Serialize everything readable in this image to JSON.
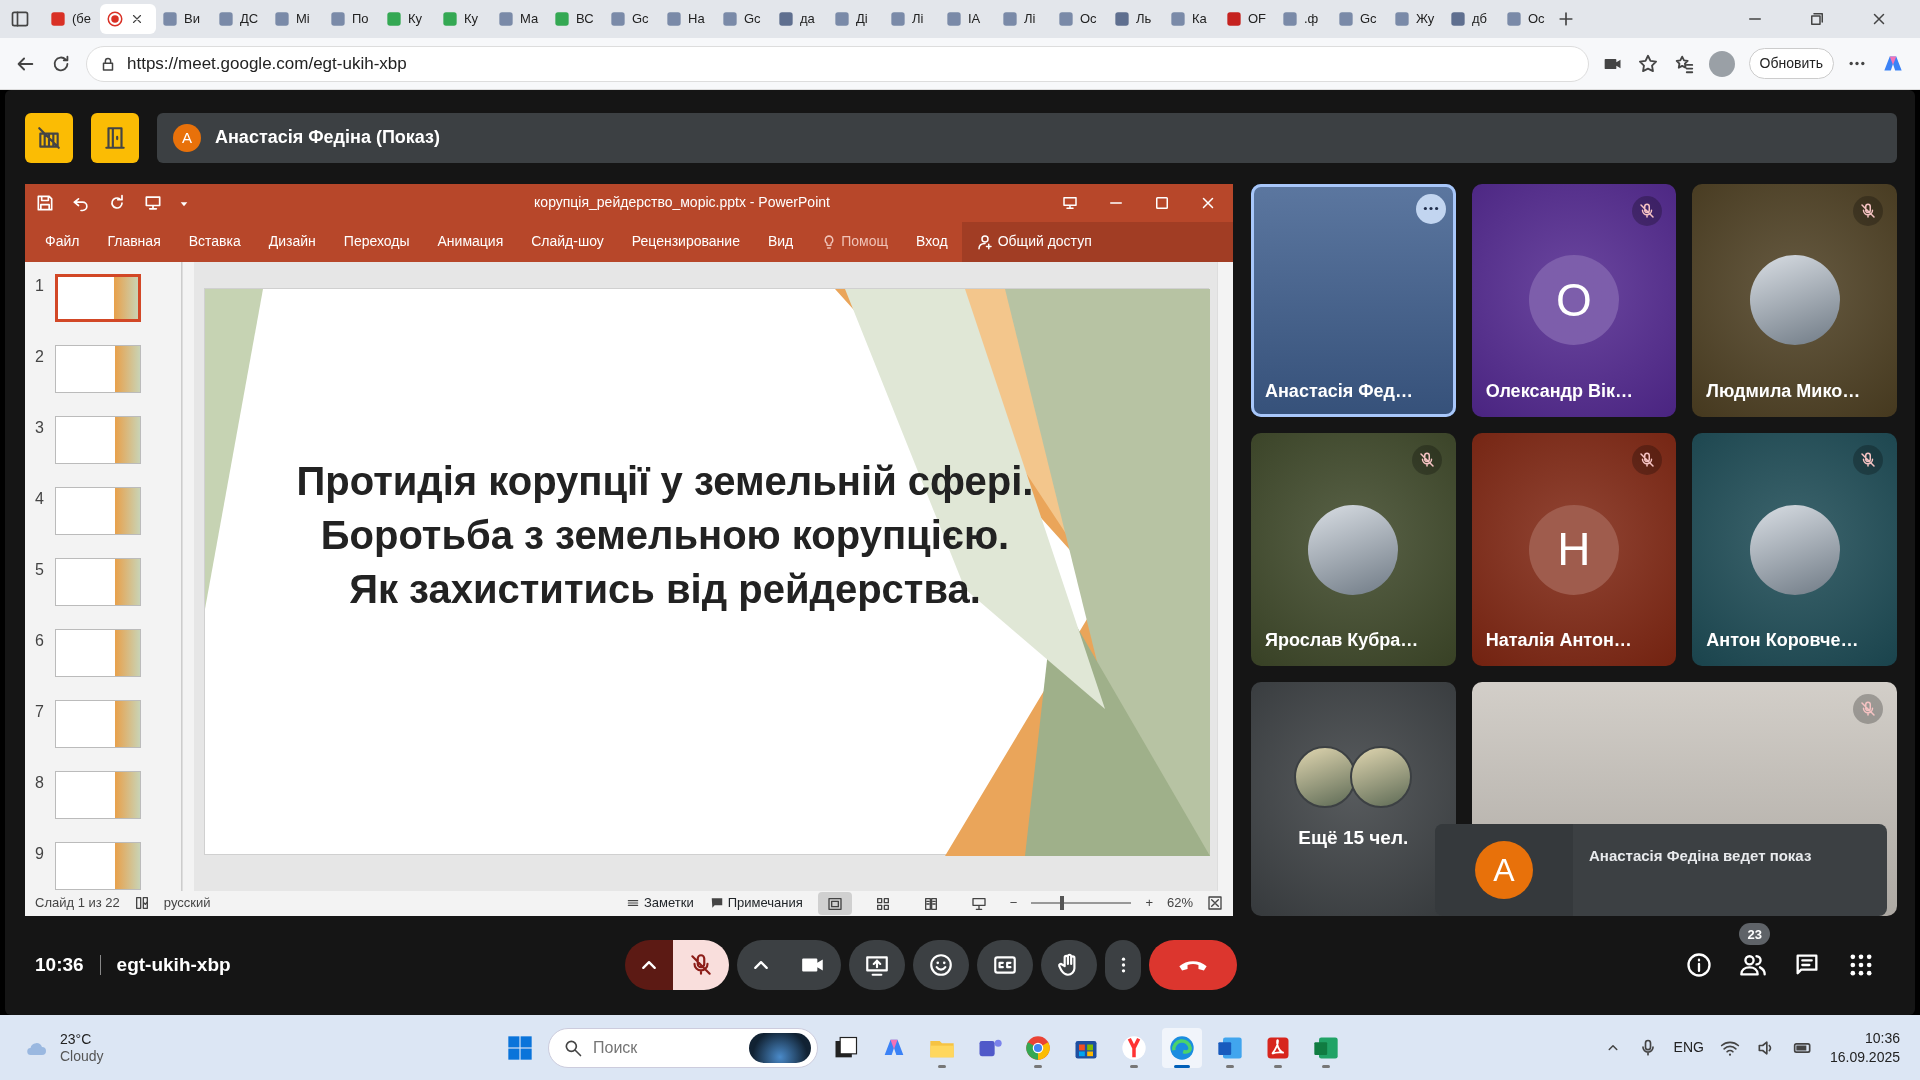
{
  "browser": {
    "tabs": [
      {
        "kind": "mail",
        "label": "(бе",
        "selected": false
      },
      {
        "kind": "recording",
        "selected": true
      },
      {
        "kind": "page",
        "label": "Ви",
        "selected": false
      },
      {
        "kind": "page",
        "label": "ДС",
        "selected": false
      },
      {
        "kind": "page",
        "label": "Мі",
        "selected": false
      },
      {
        "kind": "page",
        "label": "По",
        "selected": false
      },
      {
        "kind": "sheet",
        "label": "Ку",
        "selected": false
      },
      {
        "kind": "sheet",
        "label": "Ку",
        "selected": false
      },
      {
        "kind": "page",
        "label": "Ма",
        "selected": false
      },
      {
        "kind": "sheet",
        "label": "ВС",
        "selected": false
      },
      {
        "kind": "page",
        "label": "Gc",
        "selected": false
      },
      {
        "kind": "page",
        "label": "На",
        "selected": false
      },
      {
        "kind": "page",
        "label": "Gc",
        "selected": false
      },
      {
        "kind": "search",
        "label": "да",
        "selected": false
      },
      {
        "kind": "page",
        "label": "Ді",
        "selected": false
      },
      {
        "kind": "page",
        "label": "Лі",
        "selected": false
      },
      {
        "kind": "page",
        "label": "ІА",
        "selected": false
      },
      {
        "kind": "page",
        "label": "Лі",
        "selected": false
      },
      {
        "kind": "page",
        "label": "Ос",
        "selected": false
      },
      {
        "kind": "search",
        "label": "Ль",
        "selected": false
      },
      {
        "kind": "page",
        "label": "Ка",
        "selected": false
      },
      {
        "kind": "pdf",
        "label": "OF",
        "selected": false
      },
      {
        "kind": "page",
        "label": ".ф",
        "selected": false
      },
      {
        "kind": "page",
        "label": "Gc",
        "selected": false
      },
      {
        "kind": "page",
        "label": "Жу",
        "selected": false
      },
      {
        "kind": "search",
        "label": "дб",
        "selected": false
      },
      {
        "kind": "page",
        "label": "Ос",
        "selected": false
      }
    ],
    "url": "https://meet.google.com/egt-ukih-xbp",
    "update_button": "Обновить"
  },
  "meet": {
    "presenter_bar": {
      "initial": "А",
      "text": "Анастасія Федіна (Показ)"
    },
    "powerpoint": {
      "title": "корупція_рейдерство_моріс.pptx - PowerPoint",
      "ribbon_tabs": [
        "Файл",
        "Главная",
        "Вставка",
        "Дизайн",
        "Переходы",
        "Анимация",
        "Слайд-шоу",
        "Рецензирование",
        "Вид"
      ],
      "help": "Помощ",
      "sign_in": "Вход",
      "share": "Общий доступ",
      "slides": [
        {
          "number": "1",
          "selected": true
        },
        {
          "number": "2",
          "selected": false
        },
        {
          "number": "3",
          "selected": false
        },
        {
          "number": "4",
          "selected": false
        },
        {
          "number": "5",
          "selected": false
        },
        {
          "number": "6",
          "selected": false
        },
        {
          "number": "7",
          "selected": false
        },
        {
          "number": "8",
          "selected": false
        },
        {
          "number": "9",
          "selected": false
        }
      ],
      "slide_lines": [
        "Протидія корупції у земельній сфері.",
        "Боротьба з земельною корупцією.",
        "Як захиститись від рейдерства."
      ],
      "status": {
        "slide_counter": "Слайд 1 из 22",
        "language": "русский",
        "notes": "Заметки",
        "comments": "Примечания",
        "views": [
          {
            "kind": "normal",
            "selected": true
          },
          {
            "kind": "sorter",
            "selected": false
          },
          {
            "kind": "reading",
            "selected": false
          },
          {
            "kind": "show",
            "selected": false
          }
        ],
        "zoom_out": "−",
        "zoom_slider": {
          "level": 0.3
        },
        "zoom_in": "+",
        "zoom": "62%"
      }
    },
    "tiles": [
      {
        "kind": "video",
        "name": "Анастасія Фед…",
        "highlighted": true,
        "muted": false,
        "color": "#3f5f8f"
      },
      {
        "kind": "letter",
        "name": "Олександр Вік…",
        "initial": "О",
        "highlighted": false,
        "muted": true,
        "color": "#52288f"
      },
      {
        "kind": "avatar",
        "name": "Людмила Мико…",
        "highlighted": false,
        "muted": true,
        "color": "#4d3f22"
      },
      {
        "kind": "avatar",
        "name": "Ярослав Кубра…",
        "highlighted": false,
        "muted": true,
        "color": "#3e4829"
      },
      {
        "kind": "letter",
        "name": "Наталія Антон…",
        "initial": "Н",
        "highlighted": false,
        "muted": true,
        "color": "#7f2612"
      },
      {
        "kind": "avatar",
        "name": "Антон Коровче…",
        "highlighted": false,
        "muted": true,
        "color": "#1d4b55"
      },
      {
        "kind": "others",
        "label": "Ещё 15 чел.",
        "color": "#3c4043"
      },
      {
        "kind": "video",
        "highlighted": false,
        "muted": true,
        "color": "#cbc6bf"
      }
    ],
    "toast": {
      "initial": "А",
      "text": "Анастасія Федіна ведет показ"
    },
    "bar": {
      "time": "10:36",
      "meeting_code": "egt-ukih-xbp",
      "mic_on": false,
      "camera_on": true,
      "participant_count": "23"
    }
  },
  "taskbar": {
    "temperature": "23°C",
    "condition": "Cloudy",
    "search_placeholder": "Поиск",
    "apps": [
      {
        "kind": "taskview",
        "running": false,
        "selected": false
      },
      {
        "kind": "copilot",
        "running": false,
        "selected": false
      },
      {
        "kind": "explorer",
        "running": true,
        "selected": false
      },
      {
        "kind": "teams",
        "running": false,
        "selected": false
      },
      {
        "kind": "chrome",
        "running": true,
        "selected": false
      },
      {
        "kind": "store",
        "running": false,
        "selected": false
      },
      {
        "kind": "yandex",
        "running": true,
        "selected": false
      },
      {
        "kind": "edge",
        "running": true,
        "selected": true
      },
      {
        "kind": "word",
        "running": true,
        "selected": false
      },
      {
        "kind": "acrobat",
        "running": true,
        "selected": false
      },
      {
        "kind": "excel",
        "running": true,
        "selected": false
      }
    ],
    "language": "ENG",
    "time": "10:36",
    "date": "16.09.2025"
  }
}
